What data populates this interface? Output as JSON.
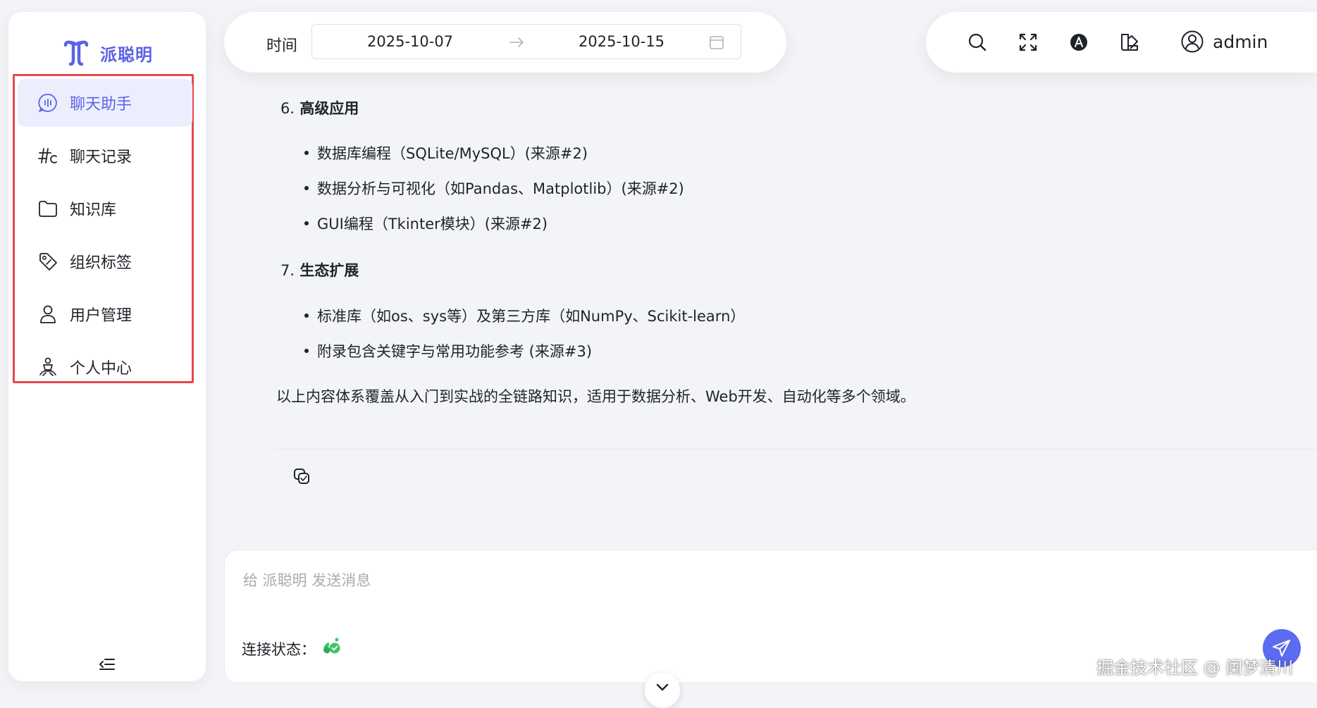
{
  "app": {
    "name": "派聪明",
    "brand_color": "#5b63e6"
  },
  "sidebar": {
    "items": [
      {
        "label": "聊天助手",
        "icon": "chat-bubble-icon",
        "active": true
      },
      {
        "label": "聊天记录",
        "icon": "history-hash-icon",
        "active": false
      },
      {
        "label": "知识库",
        "icon": "folder-icon",
        "active": false
      },
      {
        "label": "组织标签",
        "icon": "tag-icon",
        "active": false
      },
      {
        "label": "用户管理",
        "icon": "user-icon",
        "active": false
      },
      {
        "label": "个人中心",
        "icon": "profile-center-icon",
        "active": false
      }
    ],
    "collapse_icon": "collapse-menu-icon"
  },
  "header": {
    "date_label": "时间",
    "date_start": "2025-10-07",
    "date_end": "2025-10-15",
    "tools": [
      "search-icon",
      "fullscreen-icon",
      "language-icon",
      "theme-icon"
    ],
    "username": "admin"
  },
  "content": {
    "sections": [
      {
        "num": "6.",
        "title": "高级应用",
        "items": [
          "数据库编程（SQLite/MySQL）(来源#2)",
          "数据分析与可视化（如Pandas、Matplotlib）(来源#2)",
          "GUI编程（Tkinter模块）(来源#2)"
        ]
      },
      {
        "num": "7.",
        "title": "生态扩展",
        "items": [
          "标准库（如os、sys等）及第三方库（如NumPy、Scikit-learn）",
          "附录包含关键字与常用功能参考 (来源#3)"
        ]
      }
    ],
    "summary": "以上内容体系覆盖从入门到实战的全链路知识，适用于数据分析、Web开发、自动化等多个领域。"
  },
  "composer": {
    "placeholder": "给 派聪明 发送消息",
    "connection_label": "连接状态：",
    "connection_status_color": "#3cc46a",
    "send_color": "#5b6cf0"
  },
  "watermark": "掘金技术社区 @ 阑梦清川"
}
